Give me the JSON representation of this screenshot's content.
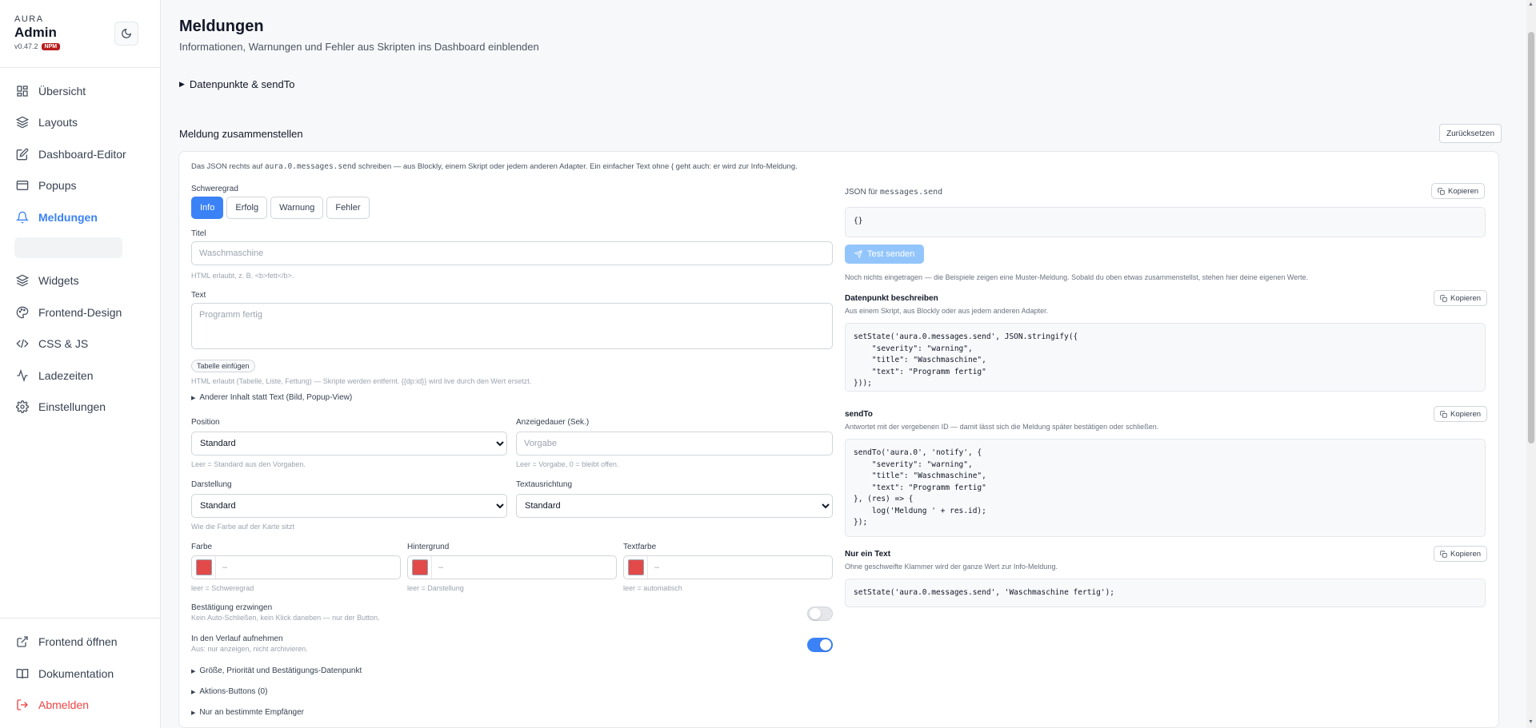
{
  "sidebar": {
    "brand_kicker": "AURA",
    "brand_name": "Admin",
    "version": "v0.47.2",
    "badge": "NPM",
    "items": [
      {
        "label": "Übersicht",
        "icon": "grid-icon"
      },
      {
        "label": "Layouts",
        "icon": "layers-icon"
      },
      {
        "label": "Dashboard-Editor",
        "icon": "edit-icon"
      },
      {
        "label": "Popups",
        "icon": "window-icon"
      },
      {
        "label": "Meldungen",
        "icon": "bell-icon"
      },
      {
        "label": "Widgets",
        "icon": "layers-icon"
      },
      {
        "label": "Frontend-Design",
        "icon": "palette-icon"
      },
      {
        "label": "CSS & JS",
        "icon": "code-icon"
      },
      {
        "label": "Ladezeiten",
        "icon": "activity-icon"
      },
      {
        "label": "Einstellungen",
        "icon": "gear-icon"
      }
    ],
    "footer": [
      {
        "label": "Frontend öffnen",
        "icon": "external-link-icon"
      },
      {
        "label": "Dokumentation",
        "icon": "book-icon"
      },
      {
        "label": "Abmelden",
        "icon": "logout-icon"
      }
    ],
    "active": "Meldungen",
    "accent": "#3b82f6",
    "danger": "#ef4444"
  },
  "page": {
    "title": "Meldungen",
    "subtitle": "Informationen, Warnungen und Fehler aus Skripten ins Dashboard einblenden",
    "disclosure": "Datenpunkte & sendTo",
    "section_title": "Meldung zusammenstellen",
    "reset": "Zurücksetzen"
  },
  "form": {
    "info_pre": "Das JSON rechts auf ",
    "info_code": "aura.0.messages.send",
    "info_post": " schreiben — aus Blockly, einem Skript oder jedem anderen Adapter. Ein einfacher Text ohne { geht auch: er wird zur Info-Meldung.",
    "severity_label": "Schweregrad",
    "severity_options": [
      "Info",
      "Erfolg",
      "Warnung",
      "Fehler"
    ],
    "severity_selected": "Info",
    "title_label": "Titel",
    "title_placeholder": "Waschmaschine",
    "title_hint": "HTML erlaubt, z. B. <b>fett</b>.",
    "text_label": "Text",
    "text_placeholder": "Programm fertig",
    "table_button": "Tabelle einfügen",
    "text_hint": "HTML erlaubt (Tabelle, Liste, Fettung) — Skripte werden entfernt. {{dp:id}} wird live durch den Wert ersetzt.",
    "alt_content": "Anderer Inhalt statt Text (Bild, Popup-View)",
    "position_label": "Position",
    "position_value": "Standard",
    "position_hint": "Leer = Standard aus den Vorgaben.",
    "duration_label": "Anzeigedauer (Sek.)",
    "duration_placeholder": "Vorgabe",
    "duration_hint": "Leer = Vorgabe, 0 = bleibt offen.",
    "display_label": "Darstellung",
    "display_value": "Standard",
    "display_hint": "Wie die Farbe auf der Karte sitzt",
    "align_label": "Textausrichtung",
    "align_value": "Standard",
    "color_label": "Farbe",
    "color_hint": "leer = Schweregrad",
    "bg_label": "Hintergrund",
    "bg_hint": "leer = Darstellung",
    "textcolor_label": "Textfarbe",
    "textcolor_hint": "leer = automatisch",
    "color_placeholder": "–",
    "swatch_color": "#e24a4a",
    "confirm_label": "Bestätigung erzwingen",
    "confirm_hint": "Kein Auto-Schließen, kein Klick daneben — nur der Button.",
    "confirm_on": false,
    "history_label": "In den Verlauf aufnehmen",
    "history_hint": "Aus: nur anzeigen, nicht archivieren.",
    "history_on": true,
    "more1": "Größe, Priorität und Bestätigungs-Datenpunkt",
    "more2": "Aktions-Buttons (0)",
    "more3": "Nur an bestimmte Empfänger"
  },
  "right": {
    "json_label_pre": "JSON für ",
    "json_label_code": "messages.send",
    "copy": "Kopieren",
    "json_value": "{}",
    "test_button": "Test senden",
    "empty_note": "Noch nichts eingetragen — die Beispiele zeigen eine Muster-Meldung. Sobald du oben etwas zusammenstellst, stehen hier deine eigenen Werte.",
    "dp_title": "Datenpunkt beschreiben",
    "dp_sub": "Aus einem Skript, aus Blockly oder aus jedem anderen Adapter.",
    "dp_code": "setState('aura.0.messages.send', JSON.stringify({\n    \"severity\": \"warning\",\n    \"title\": \"Waschmaschine\",\n    \"text\": \"Programm fertig\"\n}));",
    "sendto_title": "sendTo",
    "sendto_sub": "Antwortet mit der vergebenen ID — damit lässt sich die Meldung später bestätigen oder schließen.",
    "sendto_code": "sendTo('aura.0', 'notify', {\n    \"severity\": \"warning\",\n    \"title\": \"Waschmaschine\",\n    \"text\": \"Programm fertig\"\n}, (res) => {\n    log('Meldung ' + res.id);\n});",
    "plain_title": "Nur ein Text",
    "plain_sub": "Ohne geschweifte Klammer wird der ganze Wert zur Info-Meldung.",
    "plain_code": "setState('aura.0.messages.send', 'Waschmaschine fertig');"
  }
}
